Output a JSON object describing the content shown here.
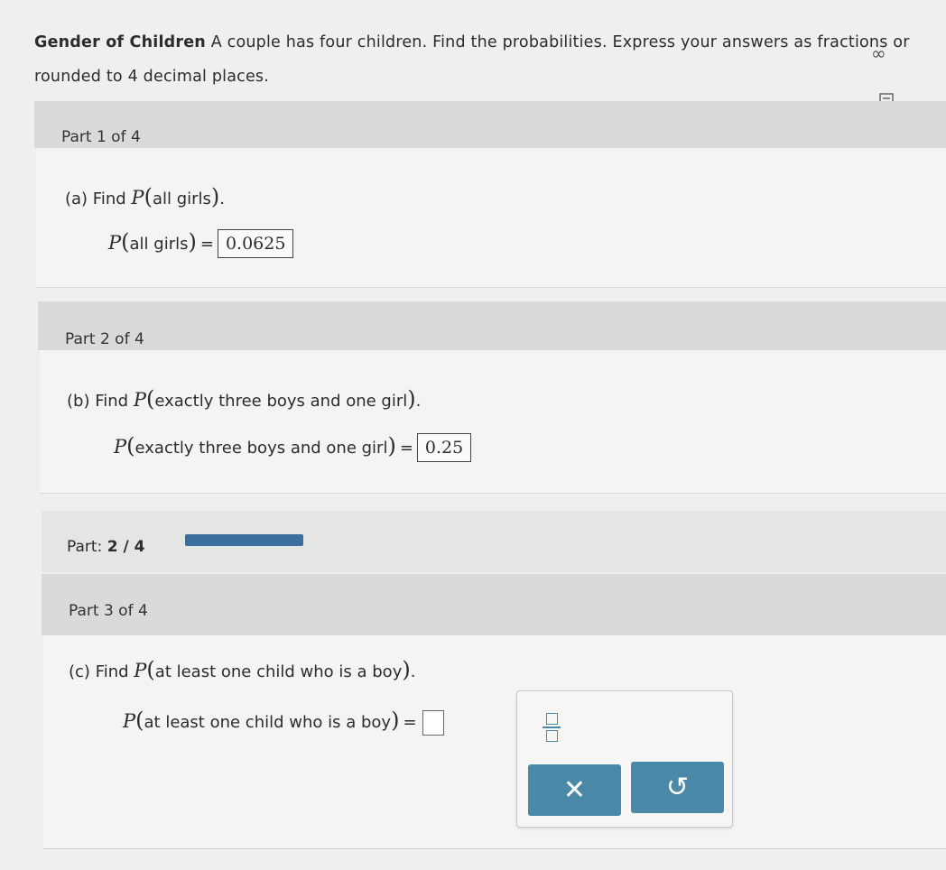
{
  "prompt": {
    "title": "Gender of Children",
    "text": "A couple has four children. Find the probabilities. Express your answers as fractions or",
    "text_line2": "rounded to 4 decimal places."
  },
  "parts": [
    {
      "header": "Part 1 of 4",
      "question_prefix": "(a)  Find",
      "question_arg": "all girls",
      "answer_label": "all girls",
      "answer_value": "0.0625"
    },
    {
      "header": "Part 2 of 4",
      "question_prefix": "(b)  Find",
      "question_arg": "exactly three boys and one girl",
      "answer_label": "exactly three boys and one girl",
      "answer_value": "0.25"
    },
    {
      "header": "Part 3 of 4",
      "question_prefix": "(c)  Find",
      "question_arg": "at least one child who is a boy",
      "answer_label": "at least one child who is a boy",
      "answer_value": ""
    }
  ],
  "math": {
    "P": "P",
    "period": ".",
    "equals": "="
  },
  "progress": {
    "label": "Part:",
    "value_text": "2 / 4",
    "fraction": 0.5
  },
  "toolbox": {
    "clear_symbol": "✕",
    "undo_symbol": "↺"
  },
  "icons": {
    "infinity": "∞"
  }
}
